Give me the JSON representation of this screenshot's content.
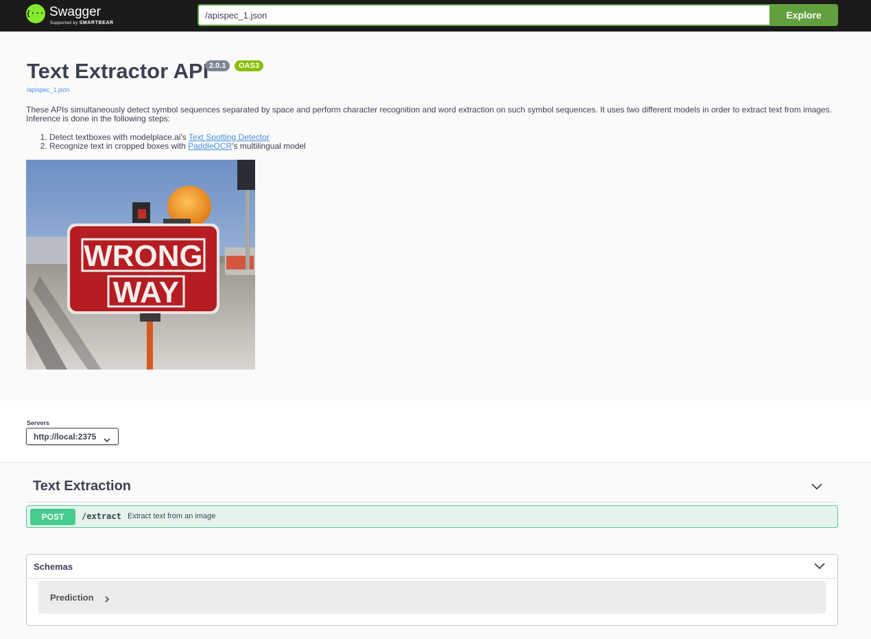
{
  "topbar": {
    "logo_icon": "{···}",
    "logo_name": "Swagger",
    "logo_tagline_prefix": "Supported by",
    "logo_tagline_brand": "SMARTBEAR",
    "url_value": "/apispec_1.json",
    "explore_label": "Explore",
    "accent": "#62a03f"
  },
  "info": {
    "title": "Text Extractor API",
    "version": "2.0.1",
    "oas": "OAS3",
    "spec_link": "/apispec_1.json",
    "description": "These APIs simultaneously detect symbol sequences separated by space and perform character recognition and word extraction on such symbol sequences. It uses two different models in order to extract text from images. Inference is done in the following steps:",
    "steps": [
      {
        "prefix": "Detect textboxes with modelplace.ai's ",
        "link": "Text Spotting Detector",
        "suffix": ""
      },
      {
        "prefix": "Recognize text in cropped boxes with ",
        "link": "PaddleOCR",
        "suffix": "'s multilingual model"
      }
    ],
    "image": {
      "sign_line1": "WRONG",
      "sign_line2": "WAY"
    }
  },
  "servers": {
    "label": "Servers",
    "selected": "http://local:2375"
  },
  "tag": {
    "name": "Text Extraction",
    "operations": [
      {
        "method": "POST",
        "path": "/extract",
        "summary": "Extract text from an image",
        "color": "#49cc90"
      }
    ]
  },
  "schemas": {
    "title": "Schemas",
    "models": [
      "Prediction"
    ]
  }
}
